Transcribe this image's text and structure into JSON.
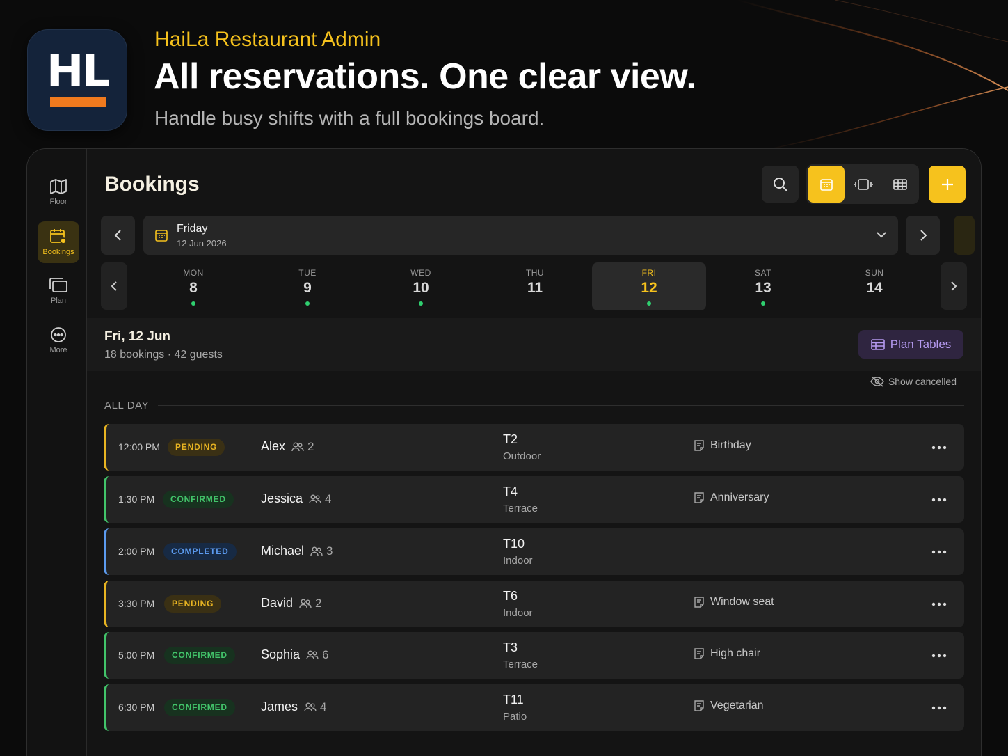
{
  "hero": {
    "app_icon_text": "HL",
    "eyebrow": "HaiLa Restaurant Admin",
    "headline": "All reservations. One clear view.",
    "subline": "Handle busy shifts with a full bookings board."
  },
  "rail": {
    "items": [
      {
        "label": "Floor",
        "icon": "map-icon",
        "active": false
      },
      {
        "label": "Bookings",
        "icon": "calendar-icon",
        "active": true
      },
      {
        "label": "Plan",
        "icon": "layers-icon",
        "active": false
      },
      {
        "label": "More",
        "icon": "more-circle-icon",
        "active": false
      }
    ]
  },
  "header": {
    "title": "Bookings",
    "view_modes": [
      "calendar-view",
      "timeline-view",
      "grid-view"
    ],
    "active_view": "calendar-view"
  },
  "date_picker": {
    "day": "Friday",
    "full_date": "12 Jun 2026"
  },
  "week": [
    {
      "name": "MON",
      "num": "8",
      "has_bookings": true,
      "selected": false
    },
    {
      "name": "TUE",
      "num": "9",
      "has_bookings": true,
      "selected": false
    },
    {
      "name": "WED",
      "num": "10",
      "has_bookings": true,
      "selected": false
    },
    {
      "name": "THU",
      "num": "11",
      "has_bookings": false,
      "selected": false
    },
    {
      "name": "FRI",
      "num": "12",
      "has_bookings": true,
      "selected": true
    },
    {
      "name": "SAT",
      "num": "13",
      "has_bookings": true,
      "selected": false
    },
    {
      "name": "SUN",
      "num": "14",
      "has_bookings": false,
      "selected": false
    }
  ],
  "summary": {
    "date": "Fri, 12 Jun",
    "counts": "18 bookings · 42 guests",
    "plan_button": "Plan Tables",
    "show_cancelled": "Show cancelled"
  },
  "section_label": "ALL DAY",
  "bookings": [
    {
      "time": "12:00 PM",
      "status": "PENDING",
      "status_kind": "pending",
      "guest": "Alex",
      "party": "2",
      "table": "T2",
      "area": "Outdoor",
      "note": "Birthday"
    },
    {
      "time": "1:30 PM",
      "status": "CONFIRMED",
      "status_kind": "confirmed",
      "guest": "Jessica",
      "party": "4",
      "table": "T4",
      "area": "Terrace",
      "note": "Anniversary"
    },
    {
      "time": "2:00 PM",
      "status": "COMPLETED",
      "status_kind": "completed",
      "guest": "Michael",
      "party": "3",
      "table": "T10",
      "area": "Indoor",
      "note": ""
    },
    {
      "time": "3:30 PM",
      "status": "PENDING",
      "status_kind": "pending",
      "guest": "David",
      "party": "2",
      "table": "T6",
      "area": "Indoor",
      "note": "Window seat"
    },
    {
      "time": "5:00 PM",
      "status": "CONFIRMED",
      "status_kind": "confirmed",
      "guest": "Sophia",
      "party": "6",
      "table": "T3",
      "area": "Terrace",
      "note": "High chair"
    },
    {
      "time": "6:30 PM",
      "status": "CONFIRMED",
      "status_kind": "confirmed",
      "guest": "James",
      "party": "4",
      "table": "T11",
      "area": "Patio",
      "note": "Vegetarian"
    }
  ],
  "colors": {
    "accent": "#f6c21d",
    "pending": "#e8b422",
    "confirmed": "#42c46a",
    "completed": "#5c9bef",
    "plan": "#b59af0"
  }
}
